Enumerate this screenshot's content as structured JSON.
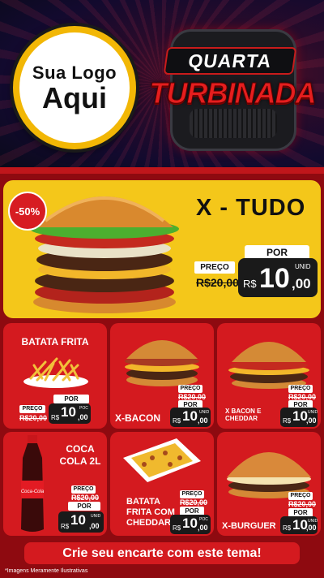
{
  "header": {
    "logo_line1": "Sua Logo",
    "logo_line2": "Aqui",
    "promo_line1": "QUARTA",
    "promo_line2": "TURBINADA"
  },
  "hero": {
    "discount": "-50%",
    "title": "X - TUDO",
    "old_label": "PREÇO",
    "old_price": "R$20,00",
    "por_label": "POR",
    "currency": "R$",
    "price_int": "10",
    "price_dec": ",00",
    "unit": "UNID"
  },
  "cards": [
    {
      "name": "BATATA FRITA",
      "old_label": "PREÇO",
      "old_price": "R$20,00",
      "por": "POR",
      "currency": "R$",
      "int": "10",
      "dec": ",00",
      "unit": "POC"
    },
    {
      "name": "X-BACON",
      "old_label": "PREÇO",
      "old_price": "R$20,00",
      "por": "POR",
      "currency": "R$",
      "int": "10",
      "dec": ",00",
      "unit": "UNID"
    },
    {
      "name": "X BACON E CHEDDAR",
      "old_label": "PREÇO",
      "old_price": "R$20,00",
      "por": "POR",
      "currency": "R$",
      "int": "10",
      "dec": ",00",
      "unit": "UNID"
    },
    {
      "name": "COCA COLA 2L",
      "old_label": "PREÇO",
      "old_price": "R$20,00",
      "por": "POR",
      "currency": "R$",
      "int": "10",
      "dec": ",00",
      "unit": "UNID"
    },
    {
      "name": "BATATA FRITA COM CHEDDAR",
      "old_label": "PREÇO",
      "old_price": "R$20,00",
      "por": "POR",
      "currency": "R$",
      "int": "10",
      "dec": ",00",
      "unit": "POC"
    },
    {
      "name": "X-BURGUER",
      "old_label": "PREÇO",
      "old_price": "R$20,00",
      "por": "POR",
      "currency": "R$",
      "int": "10",
      "dec": ",00",
      "unit": "UNID"
    }
  ],
  "bottle_brand": "Coca-Cola",
  "footer": {
    "cta": "Crie seu encarte com este tema!",
    "disclaimer": "*Imagens Meramente Ilustrativas"
  },
  "colors": {
    "accent_red": "#d41a1f",
    "dark_red": "#8e0a10",
    "yellow": "#f4c71a",
    "logo_ring": "#f2b705"
  }
}
